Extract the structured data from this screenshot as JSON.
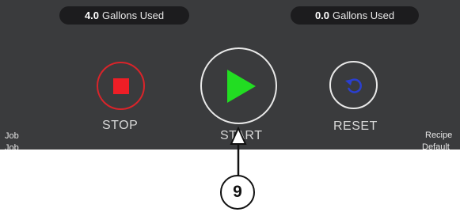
{
  "usage": {
    "left": {
      "amount": "4.0",
      "unit": "Gallons Used"
    },
    "right": {
      "amount": "0.0",
      "unit": "Gallons Used"
    }
  },
  "controls": {
    "stop_label": "STOP",
    "start_label": "START",
    "reset_label": "RESET"
  },
  "side_labels": {
    "job_line1": "Job",
    "job_line2": "Job",
    "recipe_line1": "Recipe",
    "recipe_line2": "Default"
  },
  "callout": {
    "number": "9"
  },
  "colors": {
    "panel_bg": "#3a3b3d",
    "pill_bg": "#1c1c1e",
    "stop_red": "#ee1e26",
    "play_green": "#22dd22",
    "reset_blue": "#2a3fd0"
  },
  "icons": {
    "stop": "stop-square-icon",
    "start": "play-triangle-icon",
    "reset": "circular-arrow-icon",
    "callout": "up-arrow-icon"
  }
}
